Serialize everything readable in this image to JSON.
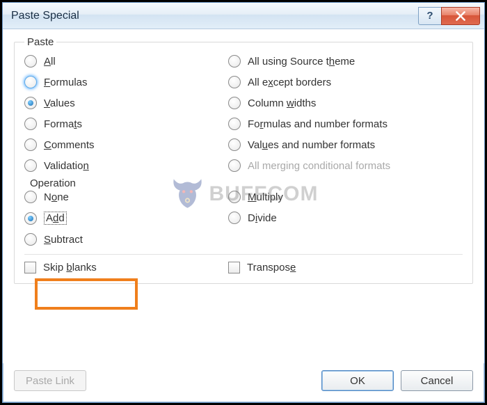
{
  "window": {
    "title": "Paste Special"
  },
  "groups": {
    "paste_label": "Paste",
    "operation_label": "Operation"
  },
  "paste": {
    "all": "All",
    "formulas": "Formulas",
    "values": "Values",
    "formats": "Formats",
    "comments": "Comments",
    "validation": "Validation",
    "all_source_theme": "All using Source theme",
    "all_except_borders": "All except borders",
    "column_widths": "Column widths",
    "formulas_number_formats": "Formulas and number formats",
    "values_number_formats": "Values and number formats",
    "all_merging_conditional": "All merging conditional formats",
    "selected": "values"
  },
  "operation": {
    "none": "None",
    "add": "Add",
    "subtract": "Subtract",
    "multiply": "Multiply",
    "divide": "Divide",
    "selected": "add"
  },
  "options": {
    "skip_blanks": "Skip blanks",
    "transpose": "Transpose"
  },
  "buttons": {
    "paste_link": "Paste Link",
    "ok": "OK",
    "cancel": "Cancel"
  },
  "watermark": {
    "text": "BUFFCOM"
  }
}
